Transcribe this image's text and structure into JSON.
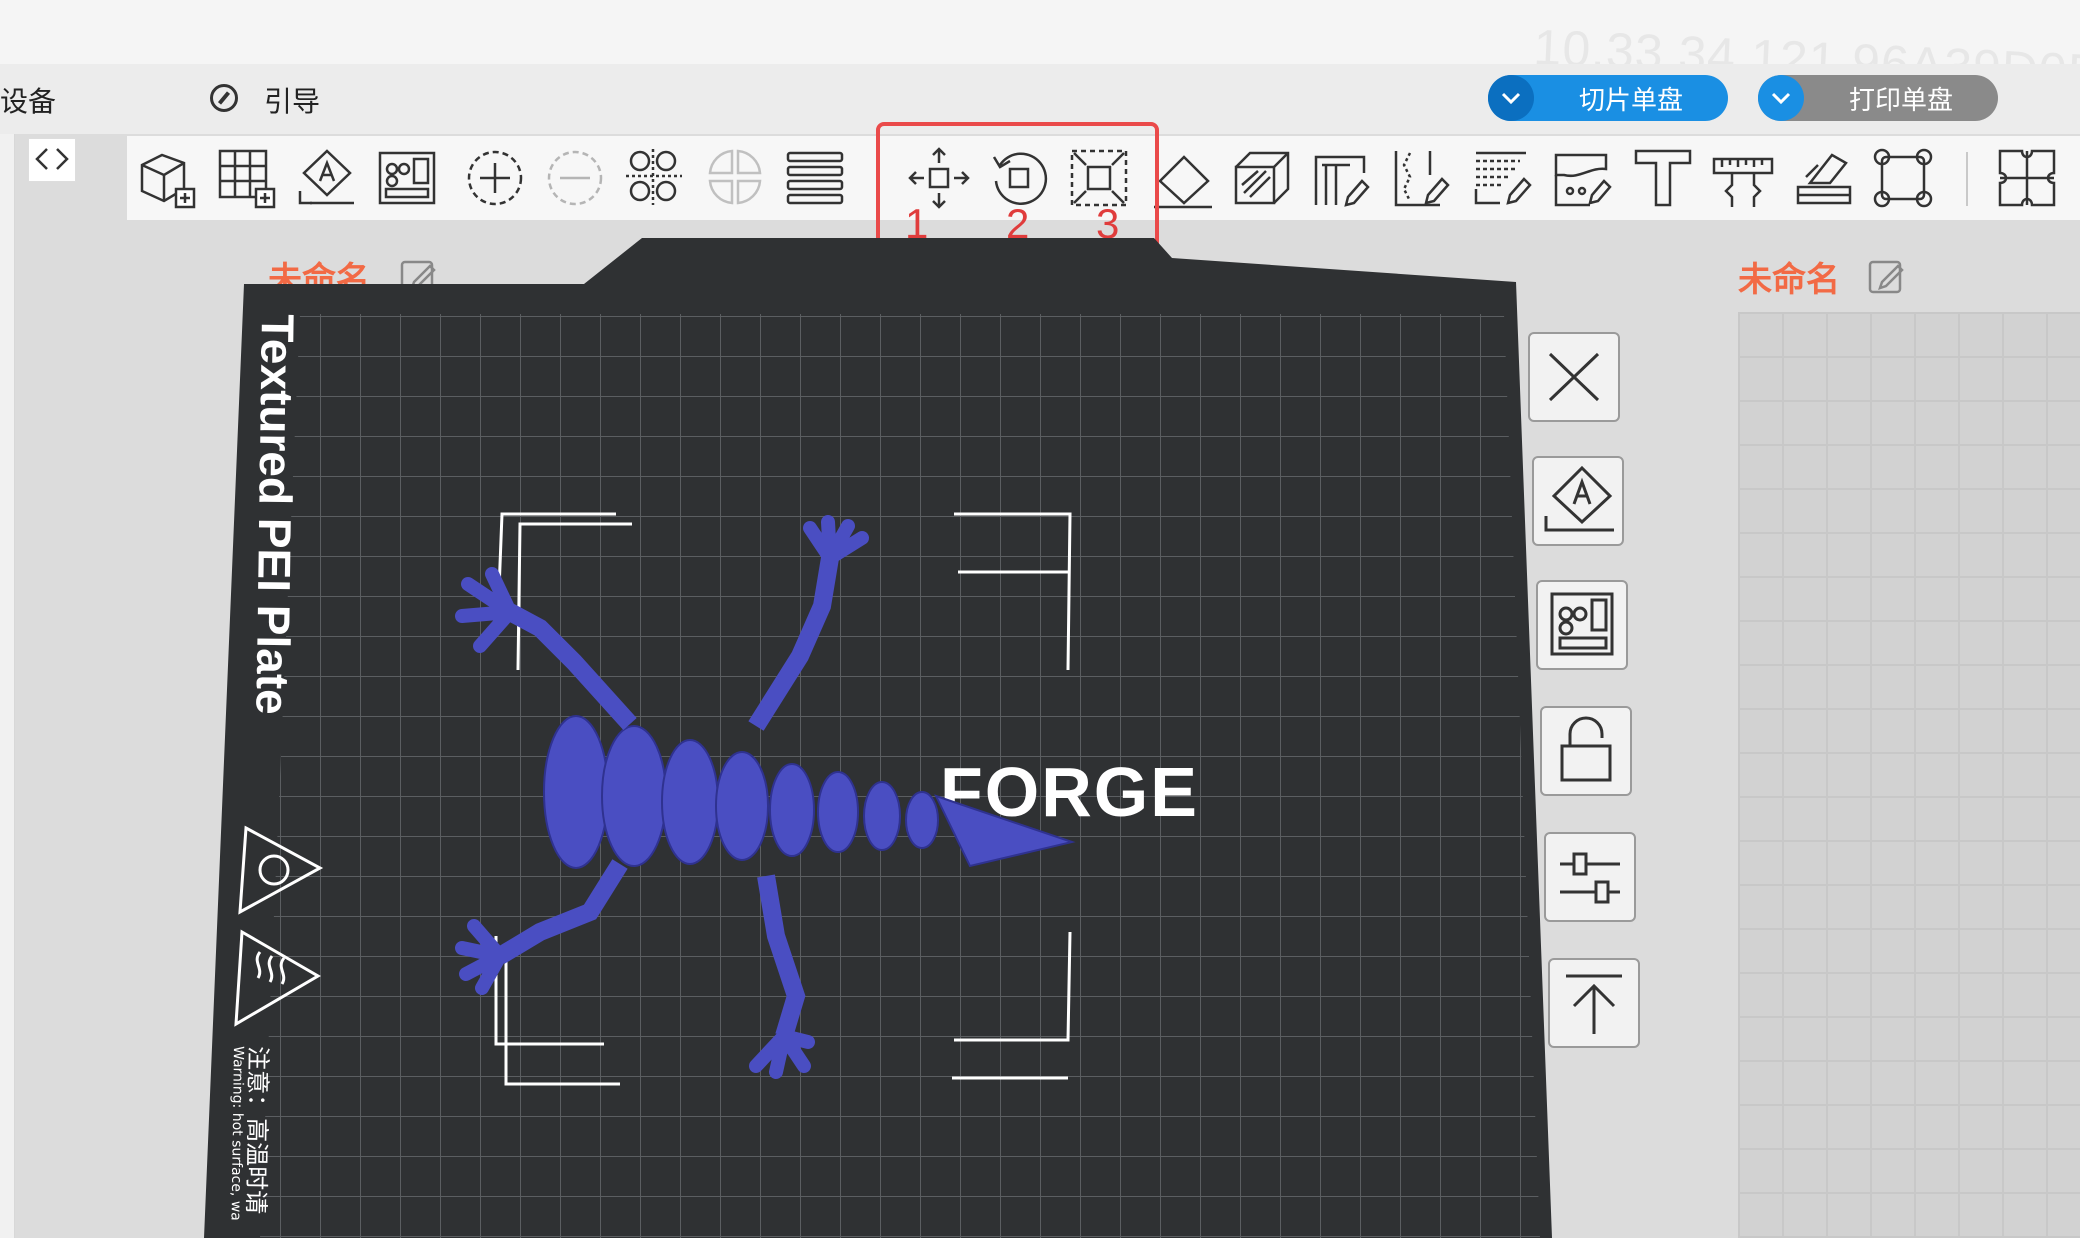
{
  "topbar": {
    "ip_watermark": "10.33.34.121  96A39D0D"
  },
  "menubar": {
    "left_label": "设备",
    "guide_label": "引导",
    "slice_button": "切片单盘",
    "print_button": "打印单盘"
  },
  "toolbar": {
    "icons": [
      "add-cube-icon",
      "grid-icon",
      "auto-orient-icon",
      "arrange-icon",
      "add-instance-icon",
      "remove-instance-icon",
      "split-objects-icon",
      "split-parts-icon",
      "layers-icon",
      "move-icon",
      "rotate-icon",
      "scale-icon",
      "lay-on-face-icon",
      "cut-icon",
      "support-paint-icon",
      "seam-paint-icon",
      "color-paint-icon",
      "brim-ears-icon",
      "text-emboss-icon",
      "measure-icon",
      "assembly-icon",
      "mesh-boolean-icon",
      "split-to-plates-icon"
    ]
  },
  "annotations": {
    "labels": [
      "1",
      "2",
      "3"
    ]
  },
  "plate": {
    "name": "未命名",
    "plate_type": "Textured PEI Plate",
    "brand_text": "FORGE",
    "warning_cn": "注意：高温时请",
    "warning_en": "Warning: hot surface, wa"
  },
  "right_plate": {
    "name": "未命名"
  },
  "plate_side_buttons": [
    "close-icon",
    "auto-orient-icon",
    "arrange-icon",
    "lock-icon",
    "settings-icon",
    "move-to-top-icon"
  ],
  "colors": {
    "accent": "#1a8fe3",
    "accent_dark": "#0b6fc0",
    "print_gray": "#8a8a8a",
    "plate": "#2f3133",
    "model": "#4a4ec2",
    "highlight": "#ea4a4a",
    "label_orange": "#f26a45"
  }
}
